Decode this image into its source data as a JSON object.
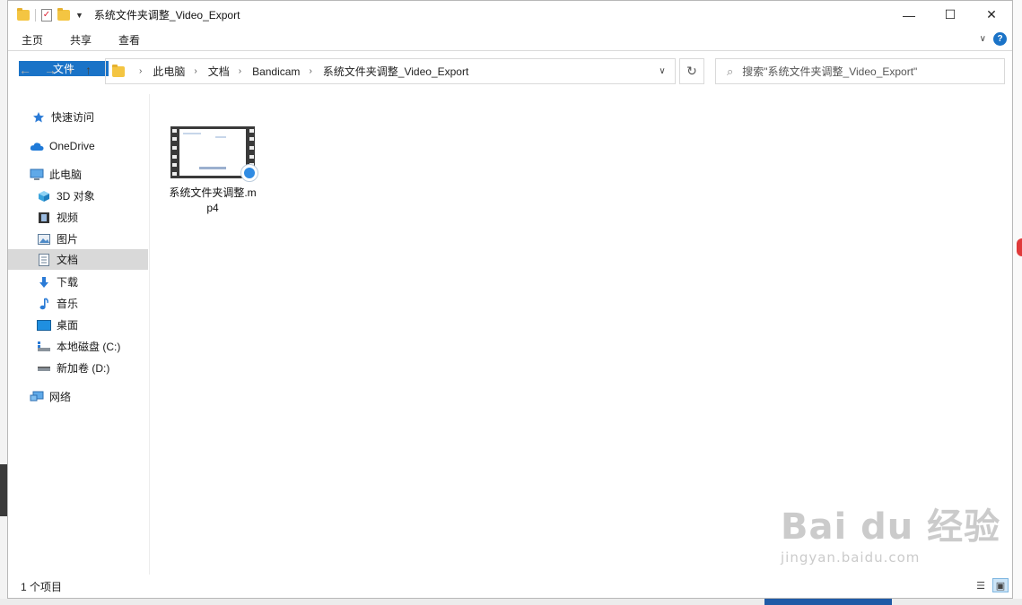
{
  "window": {
    "title": "系统文件夹调整_Video_Export",
    "controls": {
      "minimize": "—",
      "maximize": "☐",
      "close": "✕"
    }
  },
  "ribbon": {
    "tabs": [
      "文件",
      "主页",
      "共享",
      "查看"
    ],
    "help": "?"
  },
  "navigation": {
    "back": "←",
    "forward": "→",
    "recent": "∨",
    "up": "↑",
    "breadcrumbs": [
      "此电脑",
      "文档",
      "Bandicam",
      "系统文件夹调整_Video_Export"
    ],
    "search_placeholder": "搜索\"系统文件夹调整_Video_Export\""
  },
  "sidebar": {
    "items": [
      {
        "label": "快速访问",
        "icon": "star-icon"
      },
      {
        "label": "OneDrive",
        "icon": "cloud-icon"
      },
      {
        "label": "此电脑",
        "icon": "computer-icon"
      },
      {
        "label": "3D 对象",
        "icon": "cube-icon"
      },
      {
        "label": "视频",
        "icon": "film-icon"
      },
      {
        "label": "图片",
        "icon": "picture-icon"
      },
      {
        "label": "文档",
        "icon": "document-icon",
        "selected": true
      },
      {
        "label": "下载",
        "icon": "download-icon"
      },
      {
        "label": "音乐",
        "icon": "music-icon"
      },
      {
        "label": "桌面",
        "icon": "desktop-icon"
      },
      {
        "label": "本地磁盘 (C:)",
        "icon": "drive-c-icon"
      },
      {
        "label": "新加卷 (D:)",
        "icon": "drive-d-icon"
      },
      {
        "label": "网络",
        "icon": "network-icon"
      }
    ]
  },
  "files": [
    {
      "name": "系统文件夹调整.mp4",
      "icon": "video-thumbnail"
    }
  ],
  "status": {
    "count": "1 个项目"
  },
  "watermark": {
    "brand": "Bai du 经验",
    "url": "jingyan.baidu.com"
  },
  "colors": {
    "accent": "#1a73c7",
    "selected": "#d9d9d9",
    "folder": "#f4c542"
  }
}
